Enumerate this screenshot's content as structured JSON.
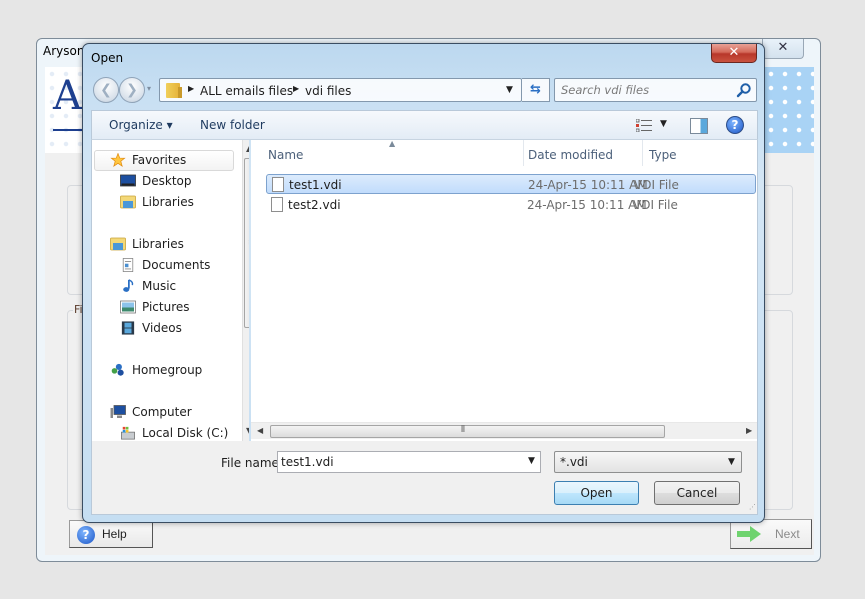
{
  "background_window": {
    "title": "Aryson",
    "close_glyph": "✕",
    "logo_letter": "A",
    "group_label_partial": "Fi",
    "help_label": "Help",
    "next_label": "Next"
  },
  "dialog": {
    "title": "Open",
    "close_glyph": "✕",
    "nav": {
      "back_glyph": "❮",
      "forward_glyph": "❯",
      "recent_glyph": "▾"
    },
    "address": {
      "breadcrumbs": [
        "ALL emails files",
        "vdi files"
      ],
      "separator_glyph": "▶",
      "dropdown_glyph": "▼",
      "refresh_glyph": "⇆"
    },
    "search": {
      "placeholder": "Search vdi files"
    },
    "toolbar": {
      "organize_label": "Organize ▾",
      "new_folder_label": "New folder",
      "views_dropdown_glyph": "▼",
      "help_glyph": "?"
    },
    "nav_pane": {
      "items": [
        {
          "label": "Favorites",
          "icon": "star-icon"
        },
        {
          "label": "Desktop",
          "icon": "desktop-icon"
        },
        {
          "label": "Libraries",
          "icon": "libraries-icon"
        },
        {
          "label": "Libraries",
          "icon": "libraries-icon"
        },
        {
          "label": "Documents",
          "icon": "documents-icon"
        },
        {
          "label": "Music",
          "icon": "music-icon"
        },
        {
          "label": "Pictures",
          "icon": "pictures-icon"
        },
        {
          "label": "Videos",
          "icon": "videos-icon"
        },
        {
          "label": "Homegroup",
          "icon": "homegroup-icon"
        },
        {
          "label": "Computer",
          "icon": "computer-icon"
        },
        {
          "label": "Local Disk (C:)",
          "icon": "local-disk-icon"
        }
      ]
    },
    "file_list": {
      "columns": [
        "Name",
        "Date modified",
        "Type"
      ],
      "sort_glyph": "▲",
      "files": [
        {
          "name": "test1.vdi",
          "date": "24-Apr-15 10:11 AM",
          "type": "VDI File",
          "selected": true
        },
        {
          "name": "test2.vdi",
          "date": "24-Apr-15 10:11 AM",
          "type": "VDI File",
          "selected": false
        }
      ]
    },
    "bottom": {
      "file_name_label": "File name:",
      "file_name_value": "test1.vdi",
      "file_type_value": "*.vdi",
      "open_label": "Open",
      "cancel_label": "Cancel"
    }
  },
  "colors": {
    "selection_fill": "#c1dcfc",
    "selection_border": "#7da2ce",
    "open_button_border": "#3c7fb1",
    "dialog_close": "#c9523f"
  }
}
